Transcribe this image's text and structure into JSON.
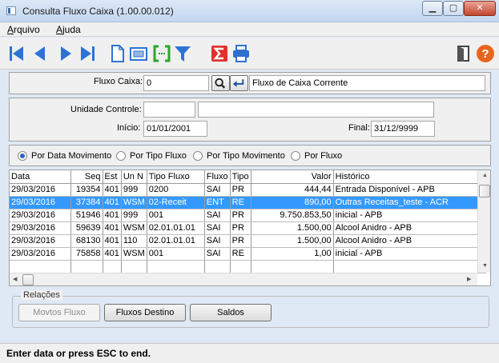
{
  "window": {
    "title": "Consulta Fluxo Caixa (1.00.00.012)",
    "min_glyph": "▁",
    "max_glyph": "▢",
    "close_glyph": "✕"
  },
  "menu": {
    "items": [
      "Arquivo",
      "Ajuda"
    ]
  },
  "toolbar": {
    "icons": [
      "first-icon",
      "prev-icon",
      "next-icon",
      "last-icon",
      "new-document-icon",
      "view-icon",
      "bracket-icon",
      "filter-icon",
      "sum-icon",
      "print-icon",
      "exit-icon",
      "help-icon"
    ],
    "help_glyph": "?"
  },
  "fluxo": {
    "label": "Fluxo Caixa:",
    "code": "0",
    "description": "Fluxo de Caixa Corrente"
  },
  "controle": {
    "unidade_label": "Unidade Controle:",
    "unidade_code": "",
    "unidade_desc": "",
    "inicio_label": "Início:",
    "inicio_value": "01/01/2001",
    "final_label": "Final:",
    "final_value": "31/12/9999"
  },
  "order": {
    "options": [
      "Por Data Movimento",
      "Por Tipo Fluxo",
      "Por Tipo Movimento",
      "Por Fluxo"
    ],
    "selected": "Por Data Movimento"
  },
  "grid": {
    "columns": [
      "Data",
      "Seq",
      "Est",
      "Un N",
      "Tipo Fluxo",
      "Fluxo",
      "Tipo",
      "Valor",
      "Histórico"
    ],
    "rows": [
      [
        "29/03/2016",
        "19354",
        "401",
        "999",
        "0200",
        "SAI",
        "PR",
        "444,44",
        "Entrada Disponível - APB"
      ],
      [
        "29/03/2016",
        "37384",
        "401",
        "WSM",
        "02-Receit",
        "ENT",
        "RE",
        "890,00",
        "Outras Receitas_teste - ACR"
      ],
      [
        "29/03/2016",
        "51946",
        "401",
        "999",
        "001",
        "SAI",
        "PR",
        "9.750.853,50",
        "inicial - APB"
      ],
      [
        "29/03/2016",
        "59639",
        "401",
        "WSM",
        "02.01.01.01",
        "SAI",
        "PR",
        "1.500,00",
        "Alcool Anidro - APB"
      ],
      [
        "29/03/2016",
        "68130",
        "401",
        "110",
        "02.01.01.01",
        "SAI",
        "PR",
        "1.500,00",
        "Alcool Anidro - APB"
      ],
      [
        "29/03/2016",
        "75858",
        "401",
        "WSM",
        "001",
        "SAI",
        "RE",
        "1,00",
        "inicial - APB"
      ]
    ],
    "selected_row": 1
  },
  "relacoes": {
    "legend": "Relações",
    "movtos": "Movtos Fluxo",
    "destino": "Fluxos Destino",
    "saldos": "Saldos"
  },
  "status": {
    "text": "Enter data or press ESC to end."
  },
  "colors": {
    "selection": "#3399ff",
    "nav_blue": "#2b74d6",
    "sum_red": "#e0322d",
    "print_blue": "#2f6fd0"
  }
}
